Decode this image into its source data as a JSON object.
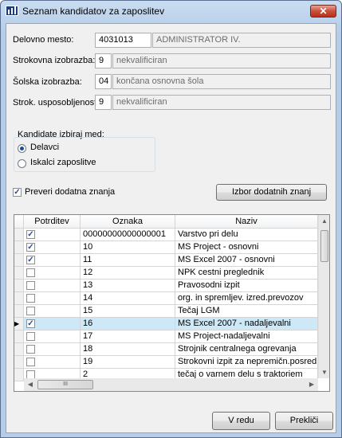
{
  "window": {
    "title": "Seznam kandidatov za zaposlitev",
    "close_label": "✕"
  },
  "form": {
    "delovno_mesto": {
      "label": "Delovno mesto:",
      "code": "4031013",
      "name": "ADMINISTRATOR IV."
    },
    "strokovna": {
      "label": "Strokovna izobrazba:",
      "code": "9",
      "name": "nekvalificiran"
    },
    "solska": {
      "label": "Šolska izobrazba:",
      "code": "04",
      "name": "končana osnovna šola"
    },
    "usposobljenost": {
      "label": "Strok. usposobljenost:",
      "code": "9",
      "name": "nekvalificiran"
    }
  },
  "candidates_group": {
    "label": "Kandidate izbiraj med:",
    "options": [
      {
        "label": "Delavci",
        "selected": true
      },
      {
        "label": "Iskalci zaposlitve",
        "selected": false
      }
    ]
  },
  "check_knowledge": {
    "label": "Preveri dodatna znanja",
    "checked": true
  },
  "select_knowledge_button": "Izbor dodatnih znanj",
  "grid": {
    "columns": [
      "Potrditev",
      "Oznaka",
      "Naziv"
    ],
    "rows": [
      {
        "checked": true,
        "code": "00000000000000001",
        "name": "Varstvo pri delu"
      },
      {
        "checked": true,
        "code": "10",
        "name": "MS Project - osnovni"
      },
      {
        "checked": true,
        "code": "11",
        "name": "MS Excel 2007 - osnovni"
      },
      {
        "checked": false,
        "code": "12",
        "name": "NPK cestni preglednik"
      },
      {
        "checked": false,
        "code": "13",
        "name": "Pravosodni izpit"
      },
      {
        "checked": false,
        "code": "14",
        "name": "org. in spremljev. izred.prevozov"
      },
      {
        "checked": false,
        "code": "15",
        "name": "Tečaj LGM"
      },
      {
        "checked": true,
        "code": "16",
        "name": "MS Excel 2007 - nadaljevalni",
        "current": true
      },
      {
        "checked": false,
        "code": "17",
        "name": "MS Project-nadaljevalni"
      },
      {
        "checked": false,
        "code": "18",
        "name": "Strojnik centralnega ogrevanja"
      },
      {
        "checked": false,
        "code": "19",
        "name": "Strokovni izpit za nepremičn.posredn"
      },
      {
        "checked": false,
        "code": "2",
        "name": "tečaj  o varnem delu s traktoriem"
      }
    ],
    "hscroll_grip": "III"
  },
  "buttons": {
    "ok": "V redu",
    "cancel": "Prekliči"
  }
}
